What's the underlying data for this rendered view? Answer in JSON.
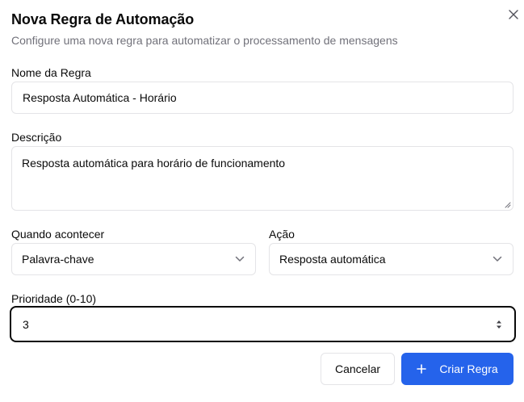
{
  "dialog": {
    "title": "Nova Regra de Automação",
    "subtitle": "Configure uma nova regra para automatizar o processamento de mensagens"
  },
  "form": {
    "name": {
      "label": "Nome da Regra",
      "value": "Resposta Automática - Horário"
    },
    "description": {
      "label": "Descrição",
      "value": "Resposta automática para horário de funcionamento"
    },
    "trigger": {
      "label": "Quando acontecer",
      "selected": "Palavra-chave"
    },
    "action": {
      "label": "Ação",
      "selected": "Resposta automática"
    },
    "priority": {
      "label": "Prioridade (0-10)",
      "value": "3"
    }
  },
  "buttons": {
    "cancel": "Cancelar",
    "create": "Criar Regra"
  },
  "colors": {
    "primary": "#2563eb",
    "muted_text": "#71717a",
    "border": "#e4e4e7"
  },
  "icons": {
    "close": "close-icon",
    "chevron": "chevron-down-icon",
    "plus": "plus-icon",
    "stepper": "stepper-icon"
  }
}
